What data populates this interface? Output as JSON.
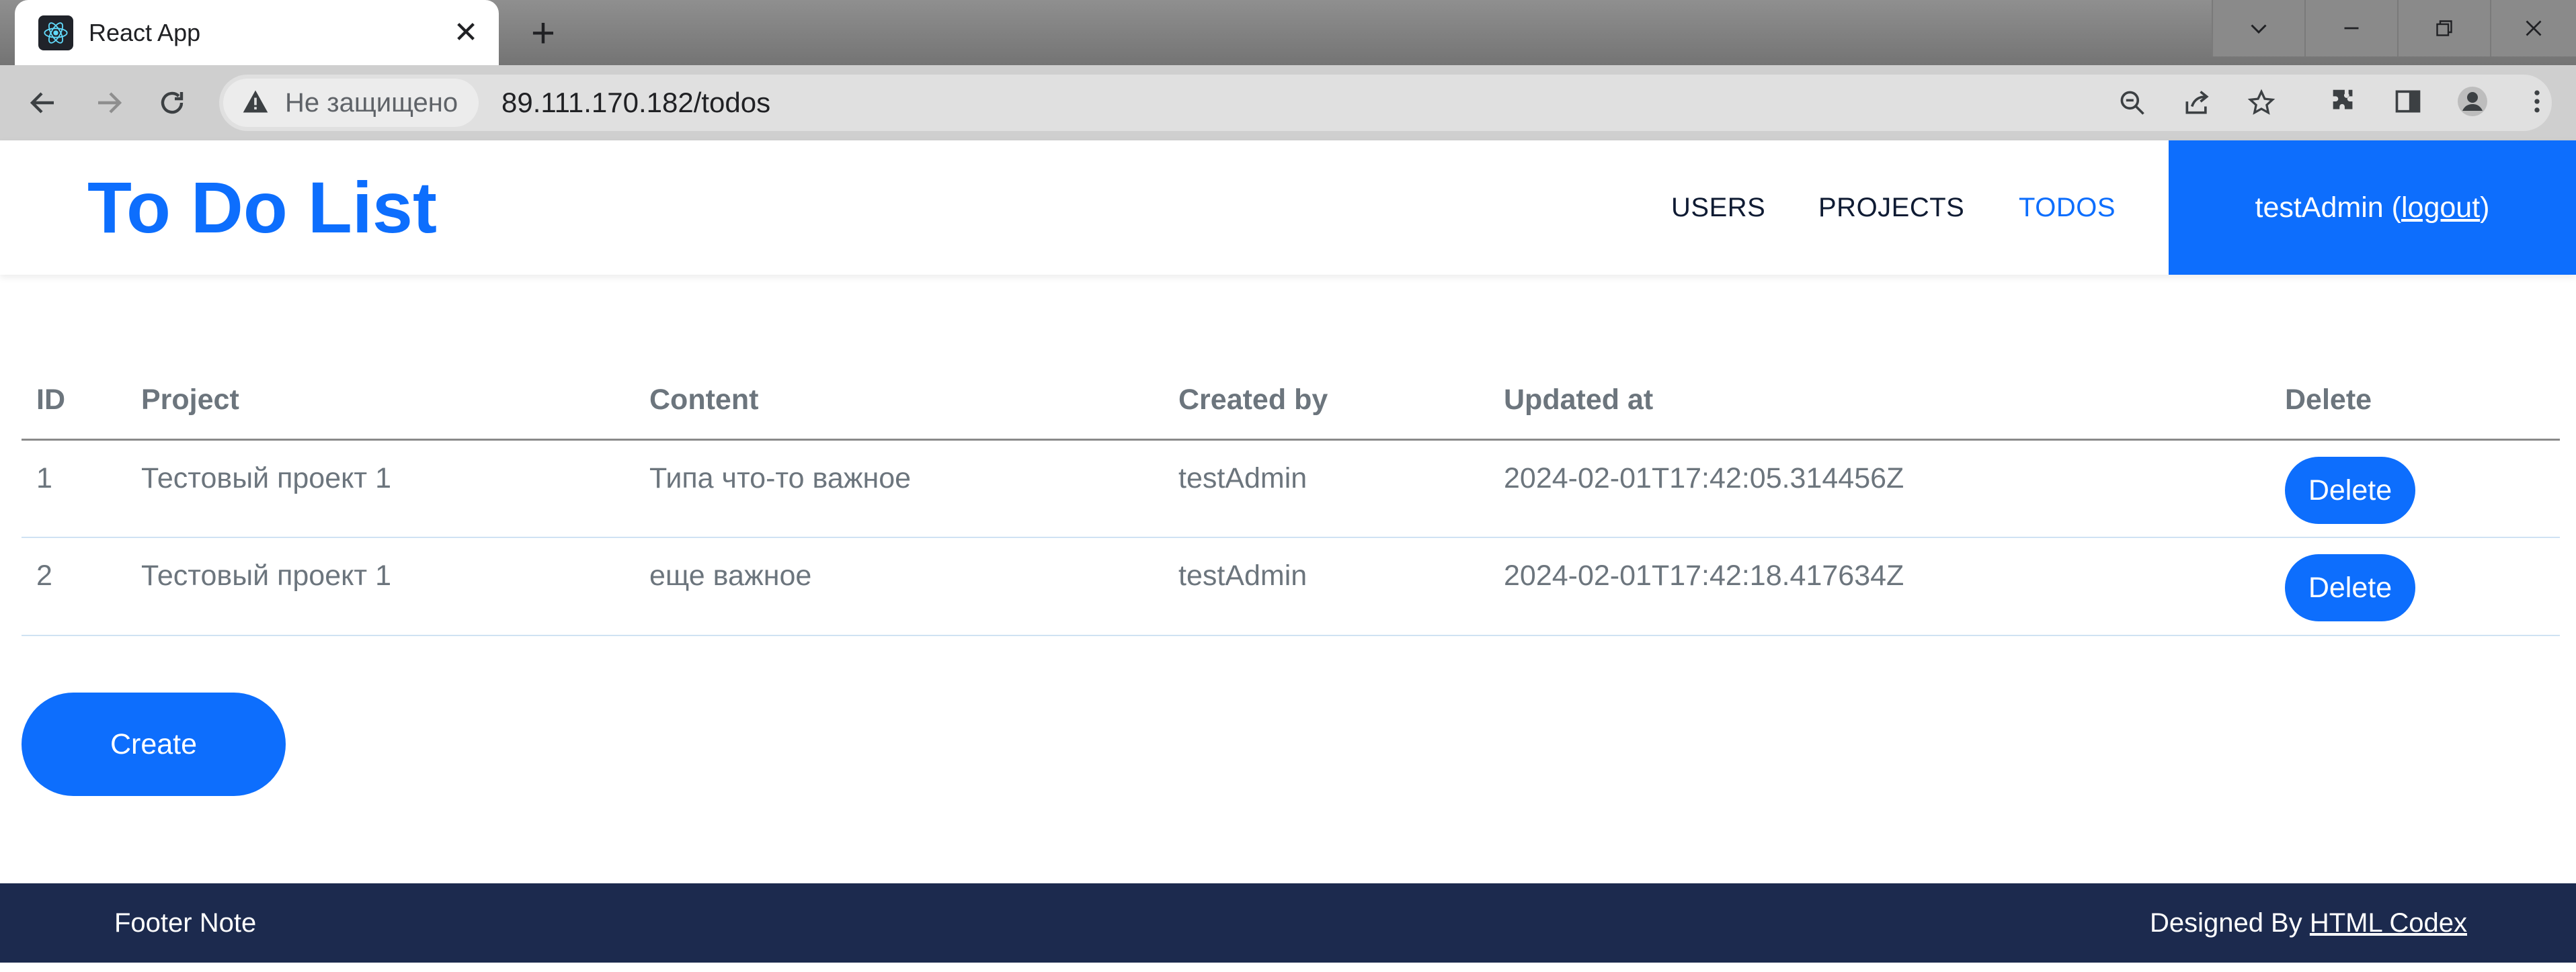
{
  "browser": {
    "tab_title": "React App",
    "address_security": "Не защищено",
    "url": "89.111.170.182/todos"
  },
  "site": {
    "brand": "To Do List",
    "nav": {
      "users": "USERS",
      "projects": "PROJECTS",
      "todos": "TODOS"
    },
    "user": {
      "username": "testAdmin",
      "logout_label": "logout"
    },
    "accent_color": "#0d6efd",
    "footer_color": "#1c2a4e"
  },
  "table": {
    "headers": [
      "ID",
      "Project",
      "Content",
      "Created by",
      "Updated at",
      "Delete"
    ],
    "rows": [
      {
        "id": "1",
        "project": "Тестовый проект 1",
        "content": "Типа что-то важное",
        "created_by": "testAdmin",
        "updated_at": "2024-02-01T17:42:05.314456Z",
        "delete_label": "Delete"
      },
      {
        "id": "2",
        "project": "Тестовый проект 1",
        "content": "еще важное",
        "created_by": "testAdmin",
        "updated_at": "2024-02-01T17:42:18.417634Z",
        "delete_label": "Delete"
      }
    ]
  },
  "create_label": "Create",
  "footer": {
    "note": "Footer Note",
    "credit_prefix": "Designed By",
    "credit_link": "HTML Codex"
  }
}
